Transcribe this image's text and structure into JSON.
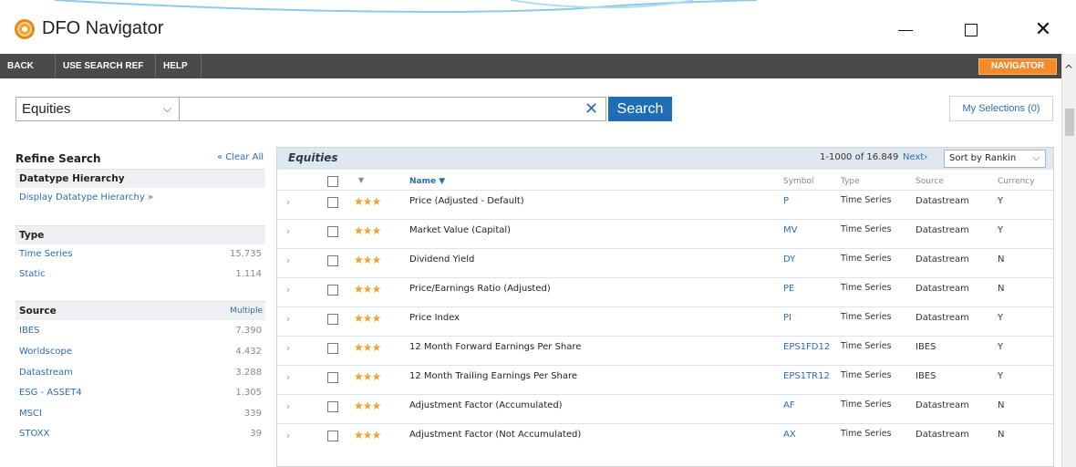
{
  "window": {
    "title": "DFO Navigator"
  },
  "menubar": {
    "items": [
      "BACK",
      "USE SEARCH REF",
      "HELP"
    ],
    "badge": "NAVIGATOR"
  },
  "search": {
    "category": "Equities",
    "query": "",
    "button": "Search",
    "my_selections": "My Selections (0)"
  },
  "sidebar": {
    "title": "Refine Search",
    "clear_all": "« Clear All",
    "sections": [
      {
        "heading": "Datatype Hierarchy",
        "items": [
          {
            "label": "Display Datatype Hierarchy »"
          }
        ]
      },
      {
        "heading": "Type",
        "items": [
          {
            "label": "Time Series",
            "count": "15.735"
          },
          {
            "label": "Static",
            "count": "1.114"
          }
        ]
      },
      {
        "heading": "Source",
        "extra": "Multiple",
        "items": [
          {
            "label": "IBES",
            "count": "7.390"
          },
          {
            "label": "Worldscope",
            "count": "4.432"
          },
          {
            "label": "Datastream",
            "count": "3.288"
          },
          {
            "label": "ESG - ASSET4",
            "count": "1.305"
          },
          {
            "label": "MSCI",
            "count": "339"
          },
          {
            "label": "STOXX",
            "count": "39"
          }
        ]
      }
    ]
  },
  "results": {
    "title": "Equities",
    "count": "1-1000 of 16.849",
    "next": "Next›",
    "sort": "Sort by Rankin",
    "columns": {
      "star": "▼",
      "name": "Name ▼",
      "symbol": "Symbol",
      "type": "Type",
      "source": "Source",
      "currency": "Currency"
    },
    "rows": [
      {
        "stars": "★★★",
        "name": "Price (Adjusted - Default)",
        "symbol": "P",
        "type": "Time Series",
        "source": "Datastream",
        "currency": "Y"
      },
      {
        "stars": "★★★",
        "name": "Market Value (Capital)",
        "symbol": "MV",
        "type": "Time Series",
        "source": "Datastream",
        "currency": "Y"
      },
      {
        "stars": "★★★",
        "name": "Dividend Yield",
        "symbol": "DY",
        "type": "Time Series",
        "source": "Datastream",
        "currency": "N"
      },
      {
        "stars": "★★★",
        "name": "Price/Earnings Ratio (Adjusted)",
        "symbol": "PE",
        "type": "Time Series",
        "source": "Datastream",
        "currency": "N"
      },
      {
        "stars": "★★★",
        "name": "Price Index",
        "symbol": "PI",
        "type": "Time Series",
        "source": "Datastream",
        "currency": "Y"
      },
      {
        "stars": "★★★",
        "name": "12 Month Forward Earnings Per Share",
        "symbol": "EPS1FD12",
        "type": "Time Series",
        "source": "IBES",
        "currency": "Y"
      },
      {
        "stars": "★★★",
        "name": "12 Month Trailing Earnings Per Share",
        "symbol": "EPS1TR12",
        "type": "Time Series",
        "source": "IBES",
        "currency": "Y"
      },
      {
        "stars": "★★★",
        "name": "Adjustment Factor (Accumulated)",
        "symbol": "AF",
        "type": "Time Series",
        "source": "Datastream",
        "currency": "N"
      },
      {
        "stars": "★★★",
        "name": "Adjustment Factor (Not Accumulated)",
        "symbol": "AX",
        "type": "Time Series",
        "source": "Datastream",
        "currency": "N"
      }
    ]
  }
}
